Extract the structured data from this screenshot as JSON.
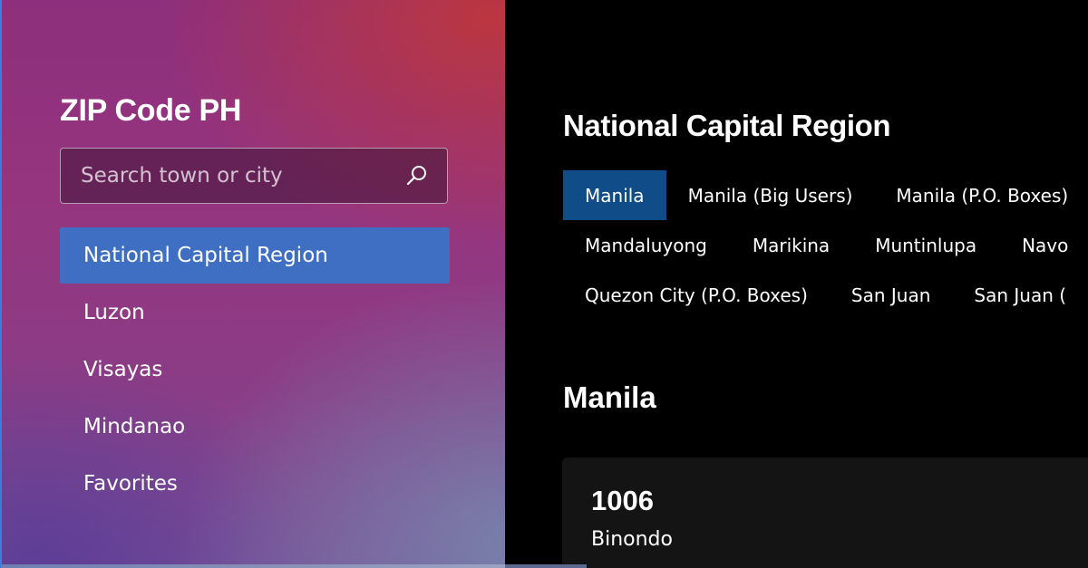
{
  "app": {
    "title": "ZIP Code PH"
  },
  "search": {
    "placeholder": "Search town or city",
    "value": "",
    "icon": "search-icon"
  },
  "nav": {
    "items": [
      {
        "label": "National Capital Region",
        "selected": true
      },
      {
        "label": "Luzon",
        "selected": false
      },
      {
        "label": "Visayas",
        "selected": false
      },
      {
        "label": "Mindanao",
        "selected": false
      },
      {
        "label": "Favorites",
        "selected": false
      }
    ]
  },
  "main": {
    "region_title": "National Capital Region",
    "city_tabs": {
      "row1": [
        "Manila",
        "Manila (Big Users)",
        "Manila (P.O. Boxes)"
      ],
      "row2": [
        "Mandaluyong",
        "Marikina",
        "Muntinlupa",
        "Navo"
      ],
      "row3": [
        "Quezon City (P.O. Boxes)",
        "San Juan",
        "San Juan ("
      ],
      "selected": "Manila"
    },
    "section_title": "Manila",
    "cards": [
      {
        "zip": "1006",
        "place": "Binondo"
      }
    ]
  },
  "colors": {
    "selected_nav": "#3e6fc3",
    "selected_tab": "#0f4c88",
    "card_bg": "#141414",
    "main_bg": "#000000"
  }
}
